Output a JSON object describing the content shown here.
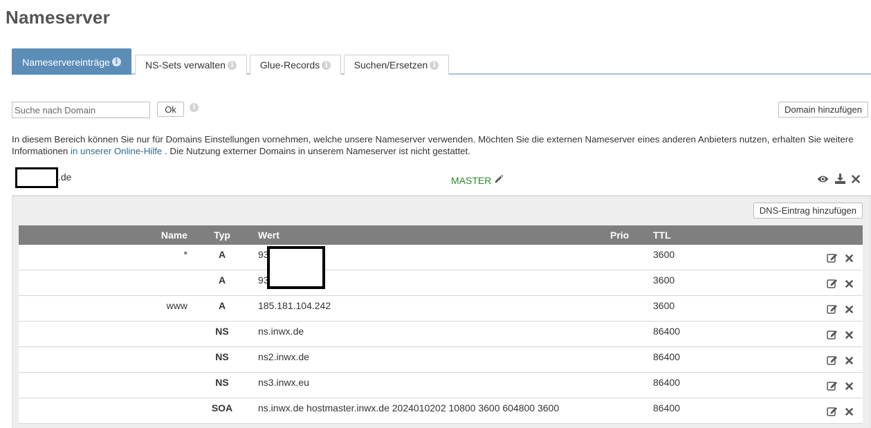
{
  "page": {
    "title": "Nameserver"
  },
  "tabs": [
    {
      "label": "Nameservereinträge",
      "active": true
    },
    {
      "label": "NS-Sets verwalten",
      "active": false
    },
    {
      "label": "Glue-Records",
      "active": false
    },
    {
      "label": "Suchen/Ersetzen",
      "active": false
    }
  ],
  "search": {
    "placeholder": "Suche nach Domain",
    "value": "",
    "ok_label": "Ok"
  },
  "toolbar": {
    "add_domain_label": "Domain hinzufügen"
  },
  "info": {
    "text_before": "In diesem Bereich können Sie nur für Domains Einstellungen vornehmen, welche unsere Nameserver verwenden. Möchten Sie die externen Nameserver eines anderen Anbieters nutzen, erhalten Sie weitere Informationen ",
    "link_text": "in unserer Online-Hilfe",
    "text_after": " . Die Nutzung externer Domains in unserem Nameserver ist nicht gestattet."
  },
  "domain": {
    "suffix": ".de",
    "type_label": "MASTER",
    "icons": [
      "eye-icon",
      "download-icon",
      "close-icon"
    ]
  },
  "dns": {
    "add_entry_label": "DNS-Eintrag hinzufügen",
    "columns": {
      "name": "Name",
      "typ": "Typ",
      "wert": "Wert",
      "prio": "Prio",
      "ttl": "TTL"
    },
    "rows": [
      {
        "name": "*",
        "typ": "A",
        "wert": "93",
        "prio": "",
        "ttl": "3600"
      },
      {
        "name": "",
        "typ": "A",
        "wert": "93",
        "prio": "",
        "ttl": "3600"
      },
      {
        "name": "www",
        "typ": "A",
        "wert": "185.181.104.242",
        "prio": "",
        "ttl": "3600"
      },
      {
        "name": "",
        "typ": "NS",
        "wert": "ns.inwx.de",
        "prio": "",
        "ttl": "86400"
      },
      {
        "name": "",
        "typ": "NS",
        "wert": "ns2.inwx.de",
        "prio": "",
        "ttl": "86400"
      },
      {
        "name": "",
        "typ": "NS",
        "wert": "ns3.inwx.eu",
        "prio": "",
        "ttl": "86400"
      },
      {
        "name": "",
        "typ": "SOA",
        "wert": "ns.inwx.de hostmaster.inwx.de 2024010202 10800 3600 604800 3600",
        "prio": "",
        "ttl": "86400"
      }
    ],
    "row_icons": [
      "edit-icon",
      "delete-icon"
    ]
  },
  "colors": {
    "tab_active": "#5b8db7",
    "header_bg": "#7f7f7f",
    "master": "#2a8a2a",
    "link": "#2b6a96"
  }
}
